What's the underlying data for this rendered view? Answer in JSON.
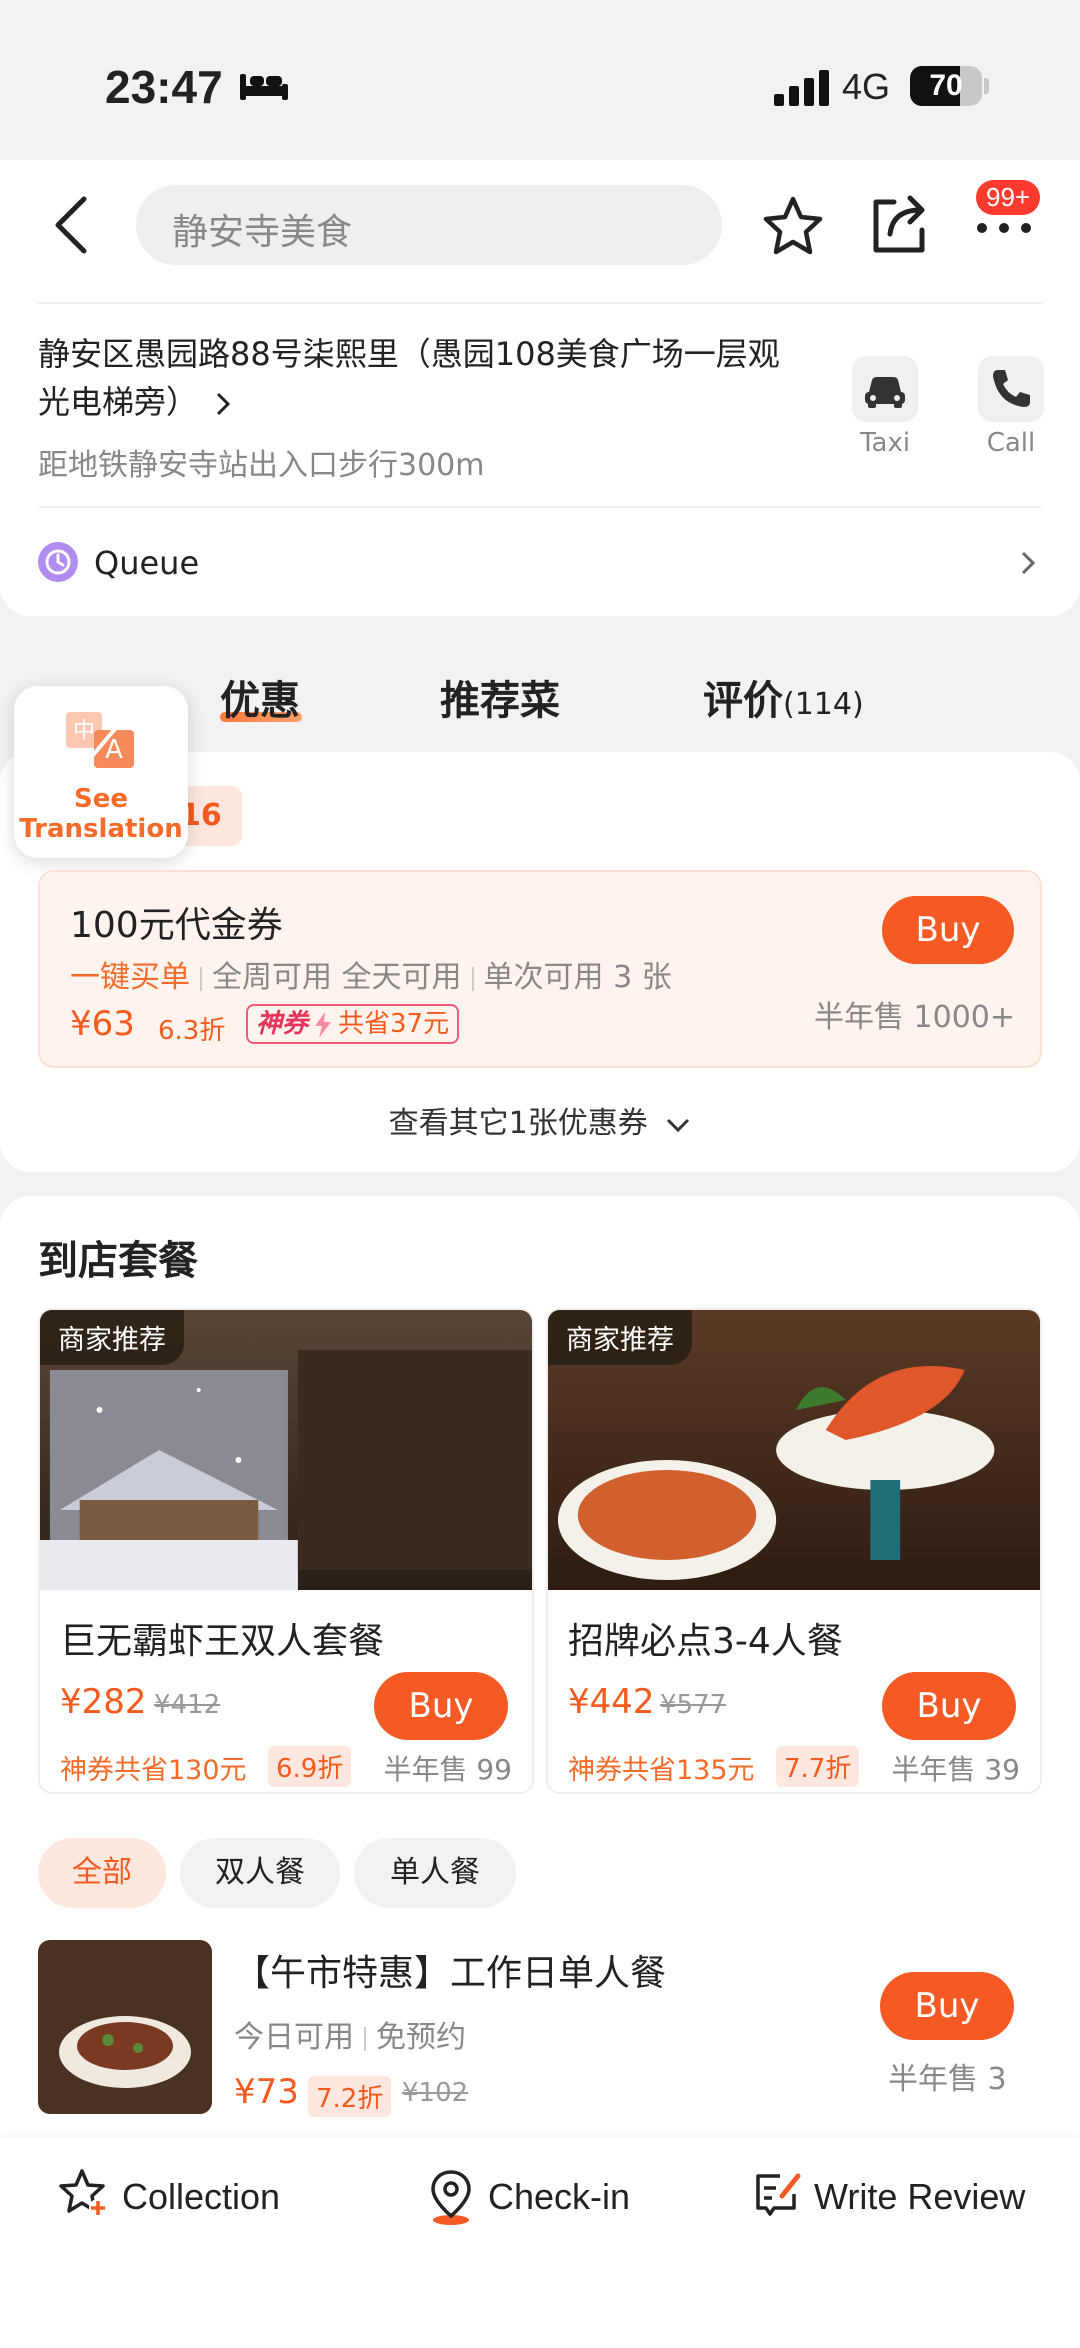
{
  "status_bar": {
    "time": "23:47",
    "network": "4G",
    "battery": "70",
    "battery_level": 0.7
  },
  "header": {
    "search_placeholder": "静安寺美食",
    "notification_badge": "99+"
  },
  "shop": {
    "address": "静安区愚园路88号柒熙里（愚园108美食广场一层观光电梯旁）",
    "sub_address": "距地铁静安寺站出入口步行300m",
    "taxi_label": "Taxi",
    "call_label": "Call",
    "queue_label": "Queue"
  },
  "tabs": [
    {
      "label": "优惠"
    },
    {
      "label": "推荐菜"
    },
    {
      "label": "评价",
      "count": "(114)"
    }
  ],
  "translation": {
    "label_line1": "See",
    "label_line2": "Translation"
  },
  "coupon_count_text": "16",
  "voucher": {
    "title": "100元代金券",
    "tag_highlight": "一键买单",
    "tag_1": "全周可用 全天可用",
    "tag_2": "单次可用 3 张",
    "price": "¥63",
    "discount": "6.3折",
    "save_brand": "神券",
    "save_text": "共省37元",
    "buy_label": "Buy",
    "sold": "半年售 1000+"
  },
  "more_coupons": "查看其它1张优惠券",
  "combo_section": {
    "title": "到店套餐",
    "cards": [
      {
        "tag": "商家推荐",
        "title": "巨无霸虾王双人套餐",
        "price": "¥282",
        "orig_price": "¥412",
        "buy_label": "Buy",
        "save": "神券共省130元",
        "discount": "6.9折",
        "sold": "半年售 99"
      },
      {
        "tag": "商家推荐",
        "title": "招牌必点3-4人餐",
        "price": "¥442",
        "orig_price": "¥577",
        "buy_label": "Buy",
        "save": "神券共省135元",
        "discount": "7.7折",
        "sold": "半年售 39"
      }
    ]
  },
  "filters": [
    {
      "label": "全部",
      "active": true
    },
    {
      "label": "双人餐",
      "active": false
    },
    {
      "label": "单人餐",
      "active": false
    }
  ],
  "list_item": {
    "title": "【午市特惠】工作日单人餐",
    "tag_1": "今日可用",
    "tag_2": "免预约",
    "price": "¥73",
    "discount": "7.2折",
    "orig_price": "¥102",
    "buy_label": "Buy",
    "sold": "半年售 3"
  },
  "bottom_bar": {
    "collection": "Collection",
    "checkin": "Check-in",
    "review": "Write Review"
  }
}
